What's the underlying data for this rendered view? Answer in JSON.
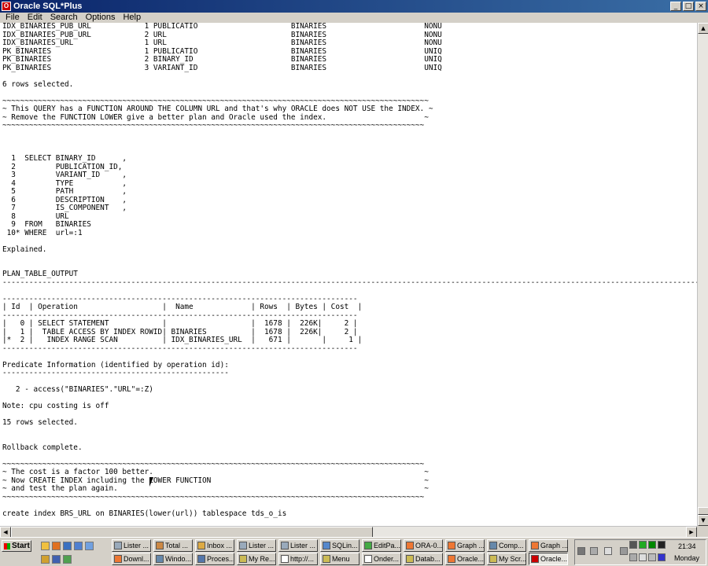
{
  "window": {
    "title": "Oracle SQL*Plus",
    "minimize": "_",
    "maximize": "□",
    "close": "×"
  },
  "menu": [
    "File",
    "Edit",
    "Search",
    "Options",
    "Help"
  ],
  "console_lines": [
    "IDX_BINARIES_PUB_URL            1 PUBLICATIO                     BINARIES                      NONU",
    "IDX_BINARIES_PUB_URL            2 URL                            BINARIES                      NONU",
    "IDX_BINARIES_URL                1 URL                            BINARIES                      NONU",
    "PK_BINARIES                     1 PUBLICATIO                     BINARIES                      UNIQ",
    "PK_BINARIES                     2 BINARY_ID                      BINARIES                      UNIQ",
    "PK_BINARIES                     3 VARIANT_ID                     BINARIES                      UNIQ",
    "",
    "6 rows selected.",
    "",
    "~~~~~~~~~~~~~~~~~~~~~~~~~~~~~~~~~~~~~~~~~~~~~~~~~~~~~~~~~~~~~~~~~~~~~~~~~~~~~~~~~~~~~~~~~~~~~~~~",
    "~ This QUERY has a FUNCTION AROUND THE COLUMN URL and that's why ORACLE does NOT USE the INDEX. ~",
    "~ Remove the FUNCTION LOWER give a better plan and Oracle used the index.                      ~",
    "~~~~~~~~~~~~~~~~~~~~~~~~~~~~~~~~~~~~~~~~~~~~~~~~~~~~~~~~~~~~~~~~~~~~~~~~~~~~~~~~~~~~~~~~~~~~~~~",
    "",
    "",
    "",
    "  1  SELECT BINARY_ID      ,",
    "  2         PUBLICATION_ID,",
    "  3         VARIANT_ID     ,",
    "  4         TYPE           ,",
    "  5         PATH           ,",
    "  6         DESCRIPTION    ,",
    "  7         IS_COMPONENT   ,",
    "  8         URL",
    "  9  FROM   BINARIES",
    " 10* WHERE  url=:1",
    "",
    "Explained.",
    "",
    "",
    "PLAN_TABLE_OUTPUT",
    "--------------------------------------------------------------------------------------------------------------------------------------------------------------",
    "",
    "--------------------------------------------------------------------------------",
    "| Id  | Operation                   |  Name             | Rows  | Bytes | Cost  |",
    "--------------------------------------------------------------------------------",
    "|   0 | SELECT STATEMENT            |                   |  1678 |  226K|     2 |",
    "|   1 |  TABLE ACCESS BY INDEX ROWID| BINARIES          |  1678 |  226K|     2 |",
    "|*  2 |   INDEX RANGE SCAN          | IDX_BINARIES_URL  |   671 |       |     1 |",
    "--------------------------------------------------------------------------------",
    "",
    "Predicate Information (identified by operation id):",
    "---------------------------------------------------",
    "",
    "   2 - access(\"BINARIES\".\"URL\"=:Z)",
    "",
    "Note: cpu costing is off",
    "",
    "15 rows selected.",
    "",
    "",
    "Rollback complete.",
    "",
    "~~~~~~~~~~~~~~~~~~~~~~~~~~~~~~~~~~~~~~~~~~~~~~~~~~~~~~~~~~~~~~~~~~~~~~~~~~~~~~~~~~~~~~~~~~~~~~~",
    "~ The cost is a factor 100 better.                                                             ~",
    "~ Now CREATE INDEX including the LOWER FUNCTION                                                ~",
    "~ and test the plan again.                                                                     ~",
    "~~~~~~~~~~~~~~~~~~~~~~~~~~~~~~~~~~~~~~~~~~~~~~~~~~~~~~~~~~~~~~~~~~~~~~~~~~~~~~~~~~~~~~~~~~~~~~~",
    "",
    "create index BRS_URL on BINARIES(lower(url)) tablespace tds_o_is",
    "",
    "|"
  ],
  "taskbar": {
    "start_label": "Start",
    "row1": [
      "Lister ...",
      "Total ...",
      "Inbox ...",
      "Lister ...",
      "Lister ...",
      "SQLin...",
      "EditPa...",
      "ORA-0...",
      "Graph ...",
      "Comp...",
      "Graph ..."
    ],
    "row2": [
      "Downl...",
      "Windo...",
      "Proces...",
      "My Re...",
      "http://...",
      "Menu",
      "Onder...",
      "Datab...",
      "Oracle...",
      "My Scr...",
      "Oracle..."
    ],
    "active_index": 10,
    "clock_time": "21:34",
    "clock_day": "Monday"
  }
}
